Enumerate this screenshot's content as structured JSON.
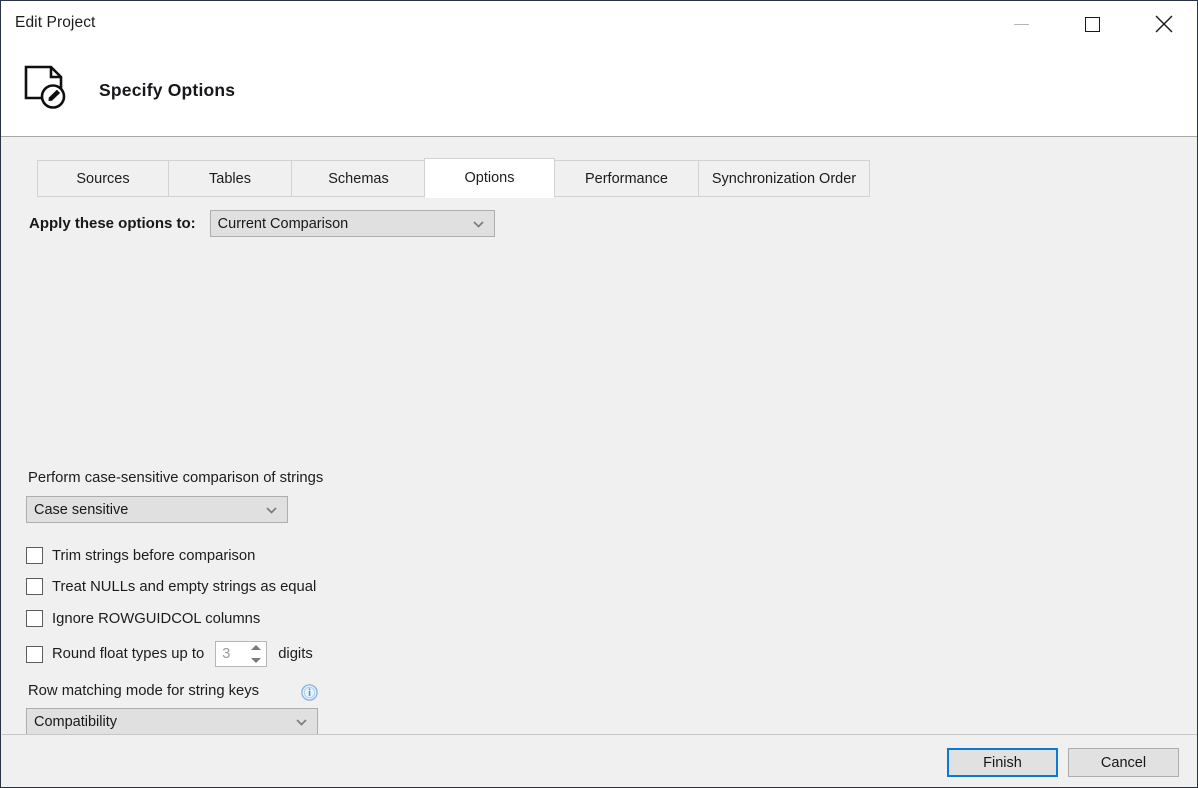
{
  "window": {
    "title": "Edit Project",
    "controls": {
      "minimize": "minimize",
      "maximize": "maximize",
      "close": "✕"
    }
  },
  "header": {
    "title": "Specify Options",
    "icon": "document-edit-icon"
  },
  "tabs": [
    {
      "label": "Sources",
      "active": false
    },
    {
      "label": "Tables",
      "active": false
    },
    {
      "label": "Schemas",
      "active": false
    },
    {
      "label": "Options",
      "active": true
    },
    {
      "label": "Performance",
      "active": false
    },
    {
      "label": "Synchronization Order",
      "active": false
    }
  ],
  "options": {
    "apply_to": {
      "label": "Apply these options to:",
      "value": "Current Comparison"
    },
    "case_sensitivity": {
      "label": "Perform case-sensitive comparison of strings",
      "value": "Case sensitive"
    },
    "checkboxes": [
      {
        "label": "Trim strings before comparison",
        "checked": false
      },
      {
        "label": "Treat NULLs and empty strings as equal",
        "checked": false
      },
      {
        "label": "Ignore ROWGUIDCOL columns",
        "checked": false
      }
    ],
    "round_float": {
      "label": "Round float types up to",
      "checked": false,
      "digits": "3",
      "suffix": "digits"
    },
    "row_matching": {
      "label": "Row matching mode for string keys",
      "info_icon": "info-icon",
      "value": "Compatibility"
    }
  },
  "footer": {
    "finish_label": "Finish",
    "cancel_label": "Cancel"
  },
  "colors": {
    "accent": "#0a7bd4",
    "content_bg": "#f0f0f0",
    "header_bg": "#ffffff",
    "info_icon": "#6aa9dd"
  }
}
